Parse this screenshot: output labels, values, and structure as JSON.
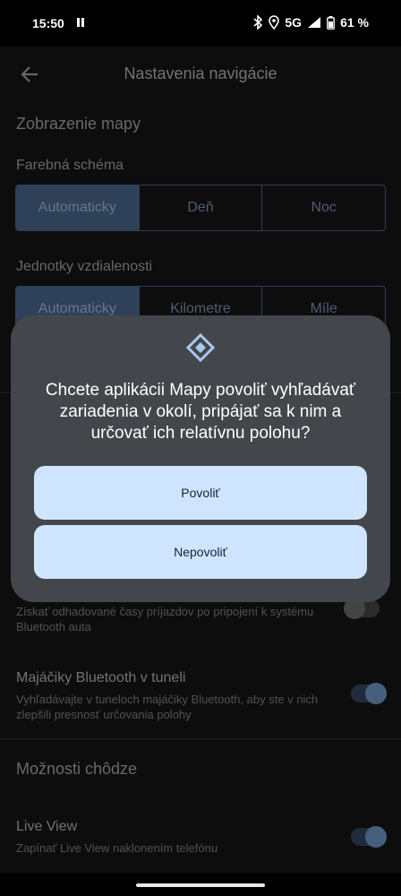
{
  "status": {
    "time": "15:50",
    "network": "5G",
    "battery": "61 %"
  },
  "header": {
    "title": "Nastavenia navigácie"
  },
  "map_display": {
    "title": "Zobrazenie mapy",
    "color_scheme_label": "Farebná schéma",
    "color_scheme_options": [
      "Automaticky",
      "Deň",
      "Noc"
    ],
    "color_scheme_selected": "Automaticky",
    "units_label": "Jednotky vzdialenosti",
    "units_options": [
      "Automaticky",
      "Kilometre",
      "Míle"
    ],
    "units_selected": "Automaticky"
  },
  "settings": {
    "car_bluetooth_sub": "Získať odhadované časy príjazdov po pripojení k systému Bluetooth auta",
    "car_bluetooth_on": false,
    "tunnel_title": "Majáčiky Bluetooth v tuneli",
    "tunnel_sub": "Vyhľadávajte v tuneloch majáčiky Bluetooth, aby ste v nich zlepšili presnosť určovania polohy",
    "tunnel_on": true
  },
  "walking": {
    "title": "Možnosti chôdze",
    "liveview_title": "Live View",
    "liveview_sub": "Zapínať Live View naklonením telefónu",
    "liveview_on": true
  },
  "dialog": {
    "icon": "nearby-devices-icon",
    "message": "Chcete aplikácii Mapy povoliť vyhľadávať zariadenia v okolí, pripájať sa k nim a určovať ich relatívnu polohu?",
    "allow_label": "Povoliť",
    "deny_label": "Nepovoliť"
  },
  "colors": {
    "accent": "#cfe5ff",
    "dialog_bg": "#43474c",
    "selected_segment": "#3e5777"
  }
}
